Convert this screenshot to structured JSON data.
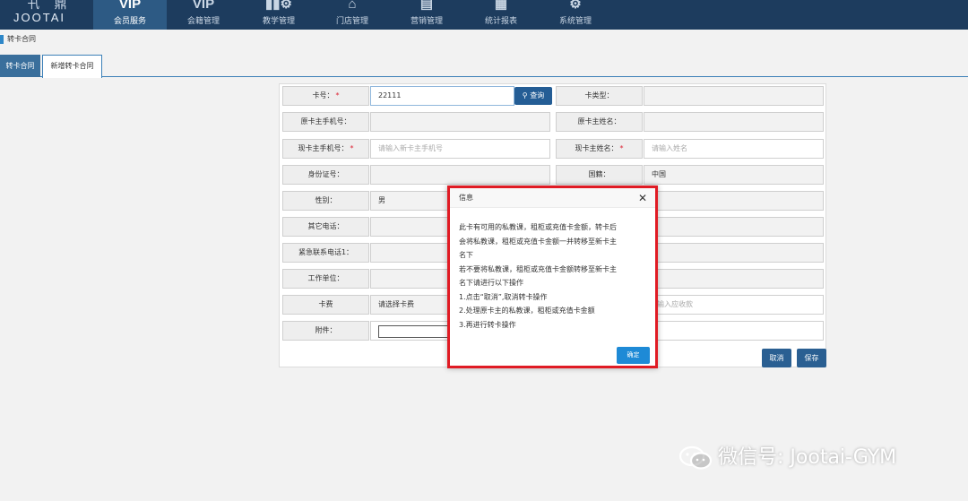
{
  "logo": {
    "cn": "卂 鼎",
    "en": "JOOTAI"
  },
  "nav": [
    {
      "glyph": "VIP",
      "label": "会员服务",
      "active": true
    },
    {
      "glyph": "VIP",
      "label": "会籍管理"
    },
    {
      "glyph": "▮▮⚙",
      "label": "教学管理"
    },
    {
      "glyph": "⌂",
      "label": "门店管理"
    },
    {
      "glyph": "▤",
      "label": "营销管理"
    },
    {
      "glyph": "▦",
      "label": "统计报表"
    },
    {
      "glyph": "⚙",
      "label": "系统管理"
    }
  ],
  "breadcrumb": "转卡合同",
  "tabs": [
    "转卡合同",
    "新增转卡合同"
  ],
  "form": {
    "card_no_label": "卡号：",
    "card_no_value": "22111",
    "search_label": "查询",
    "card_type_label": "卡类型：",
    "orig_phone_label": "原卡主手机号：",
    "orig_name_label": "原卡主姓名：",
    "new_phone_label": "现卡主手机号：",
    "new_phone_placeholder": "请输入新卡主手机号",
    "new_name_label": "现卡主姓名：",
    "new_name_placeholder": "请输入姓名",
    "id_label": "身份证号：",
    "nationality_label": "国籍：",
    "nationality_value": "中国",
    "gender_label": "性别：",
    "gender_value": "男",
    "other_phone_label": "其它电话：",
    "emergency_label": "紧急联系电话1：",
    "work_label": "工作单位：",
    "fee_label": "卡费",
    "fee_placeholder": "请选择卡费",
    "receivable_placeholder": "输入应收款",
    "attach_label": "附件：",
    "required_mark": "*",
    "cancel_label": "取消",
    "save_label": "保存"
  },
  "dialog": {
    "title": "信息",
    "close": "✕",
    "lines": [
      "此卡有可用的私教课，租柜或充值卡金额，转卡后",
      "会将私教课，租柜或充值卡金额一并转移至新卡主",
      "名下",
      "若不要将私教课，租柜或充值卡金额转移至新卡主",
      "名下请进行以下操作",
      "1.点击“取消”,取消转卡操作",
      "2.处理原卡主的私教课，租柜或充值卡金额",
      "3.再进行转卡操作"
    ],
    "ok_label": "确定"
  },
  "watermark": "微信号: Jootai-GYM",
  "colors": {
    "nav_bg": "#1d3c5e",
    "accent": "#245d95",
    "alert_border": "#e01b24",
    "ok_button": "#1e8ad6"
  }
}
